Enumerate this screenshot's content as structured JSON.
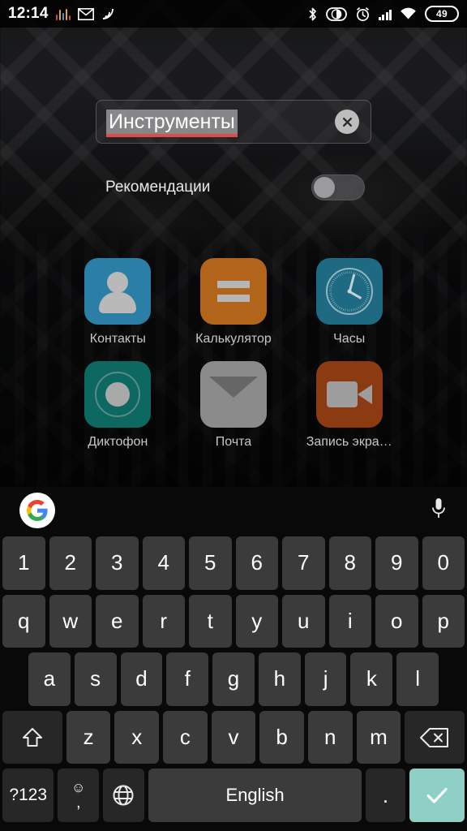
{
  "status_bar": {
    "time": "12:14",
    "battery_level": "49",
    "left_icons": [
      "equalizer-icon",
      "mail-icon",
      "rss-icon"
    ],
    "right_icons": [
      "bluetooth-icon",
      "do-not-disturb-icon",
      "alarm-icon",
      "signal-icon",
      "wifi-icon",
      "battery-icon"
    ]
  },
  "search": {
    "value": "Инструменты",
    "placeholder": "Инструменты",
    "clear_label": "✕"
  },
  "recommendations": {
    "label": "Рекомендации",
    "state": "off"
  },
  "apps": [
    {
      "label": "Контакты",
      "icon": "contacts-icon",
      "color": "#2b7fa6"
    },
    {
      "label": "Калькулятор",
      "icon": "calculator-icon",
      "color": "#b2651a"
    },
    {
      "label": "Часы",
      "icon": "clock-icon",
      "color": "#1d6a82"
    },
    {
      "label": "Диктофон",
      "icon": "voice-recorder-icon",
      "color": "#0d6861"
    },
    {
      "label": "Почта",
      "icon": "mail-icon",
      "color": "#8b8b8c"
    },
    {
      "label": "Запись экра…",
      "icon": "screen-recorder-icon",
      "color": "#8c3a12"
    }
  ],
  "keyboard": {
    "google_logo": "google-logo",
    "mic": "microphone-icon",
    "row_numbers": [
      "1",
      "2",
      "3",
      "4",
      "5",
      "6",
      "7",
      "8",
      "9",
      "0"
    ],
    "row_qwerty": [
      "q",
      "w",
      "e",
      "r",
      "t",
      "y",
      "u",
      "i",
      "o",
      "p"
    ],
    "row_asdf": [
      "a",
      "s",
      "d",
      "f",
      "g",
      "h",
      "j",
      "k",
      "l"
    ],
    "row_zxcv": [
      "z",
      "x",
      "c",
      "v",
      "b",
      "n",
      "m"
    ],
    "shift_key": "shift-key",
    "backspace_key": "backspace-key",
    "symbols_key": "?123",
    "emoji_key_top": "☺",
    "emoji_key_bottom": ",",
    "language_key": "globe-icon",
    "space_label": "English",
    "period_key": ".",
    "enter_key": "✓",
    "accent_color": "#8ed0c5"
  }
}
